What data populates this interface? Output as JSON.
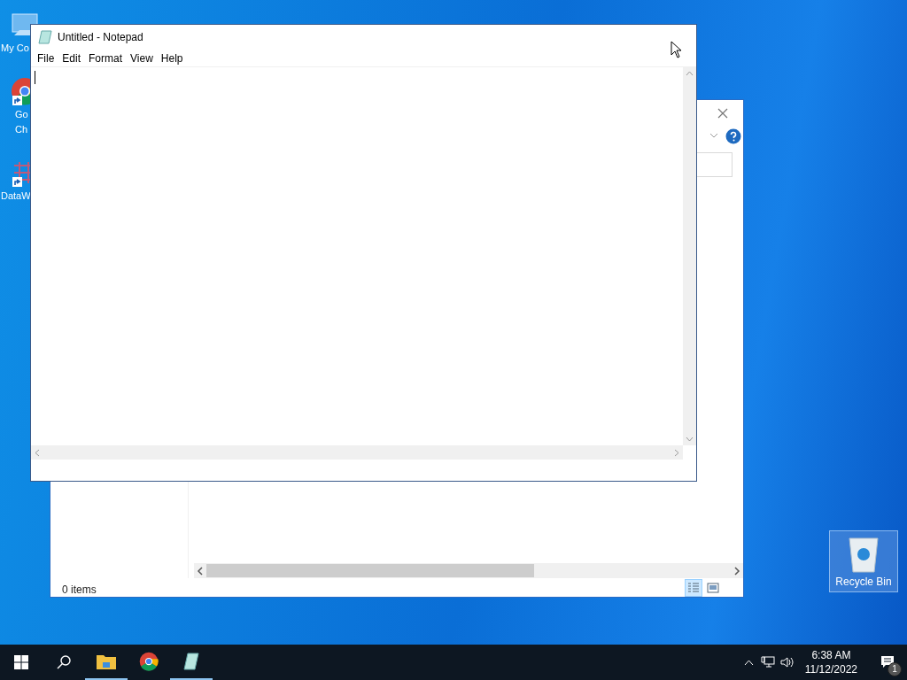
{
  "desktop_icons": [
    {
      "kind": "computer",
      "lines": [
        "My Co"
      ],
      "shortcut": false
    },
    {
      "kind": "browser",
      "lines": [
        "Go",
        "Ch"
      ],
      "shortcut": true
    },
    {
      "kind": "chart",
      "lines": [
        "DataW"
      ],
      "shortcut": true
    }
  ],
  "recycle_bin": {
    "label": "Recycle Bin",
    "selected": true
  },
  "explorer": {
    "status": "0 items",
    "views": [
      {
        "kind": "details",
        "selected": true
      },
      {
        "kind": "tiles",
        "selected": false
      }
    ]
  },
  "notepad": {
    "title": "Untitled - Notepad",
    "menu": [
      "File",
      "Edit",
      "Format",
      "View",
      "Help"
    ]
  },
  "taskbar": {
    "apps": [
      {
        "kind": "folder",
        "running": true
      },
      {
        "kind": "browser",
        "running": false
      },
      {
        "kind": "notepad",
        "running": true
      }
    ],
    "time": "6:38 AM",
    "date": "11/12/2022",
    "notifications": "1"
  }
}
